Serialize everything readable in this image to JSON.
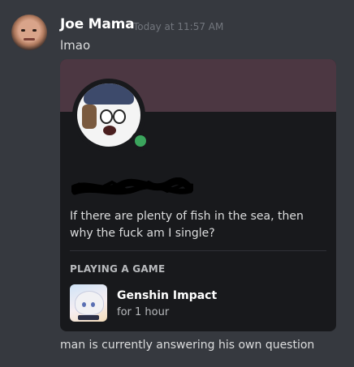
{
  "message": {
    "author": "Joe Mama",
    "timestamp": "Today at 11:57 AM",
    "text": "lmao"
  },
  "profile_card": {
    "status_color": "#3ba55d",
    "banner_color": "#4c3742",
    "about_me": "If there are plenty of fish in the sea, then why the fuck am I single?",
    "activity_header": "PLAYING A GAME",
    "game": {
      "name": "Genshin Impact",
      "elapsed": "for 1 hour"
    }
  },
  "caption": "man is currently answering his own question"
}
